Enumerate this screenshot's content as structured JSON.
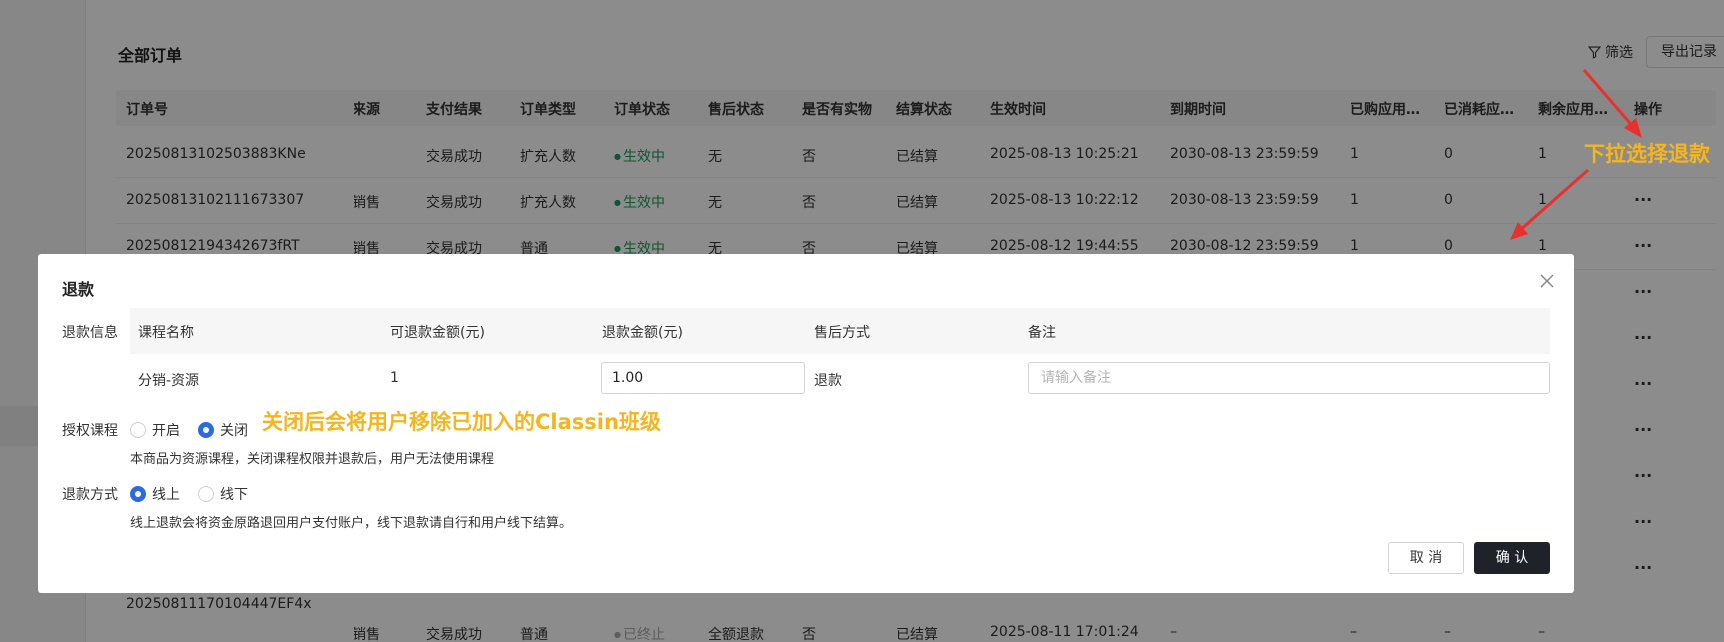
{
  "page": {
    "title": "全部订单",
    "filter_label": "筛选",
    "export_label": "导出记录"
  },
  "table": {
    "columns": [
      "订单号",
      "来源",
      "支付结果",
      "订单类型",
      "订单状态",
      "售后状态",
      "是否有实物",
      "结算状态",
      "生效时间",
      "到期时间",
      "已购应用…",
      "已消耗应…",
      "剩余应用…",
      "操作"
    ],
    "rows": [
      {
        "order_no": "20250813102503883KNe",
        "source": "",
        "pay": "交易成功",
        "type": "扩充人数",
        "status": "生效中",
        "after": "无",
        "physical": "否",
        "settle": "已结算",
        "start": "2025-08-13 10:25:21",
        "end": "2030-08-13 23:59:59",
        "bought": "1",
        "used": "0",
        "left": "1"
      },
      {
        "order_no": "20250813102111673307",
        "source": "销售",
        "pay": "交易成功",
        "type": "扩充人数",
        "status": "生效中",
        "after": "无",
        "physical": "否",
        "settle": "已结算",
        "start": "2025-08-13 10:22:12",
        "end": "2030-08-13 23:59:59",
        "bought": "1",
        "used": "0",
        "left": "1"
      },
      {
        "order_no": "20250812194342673fRT",
        "source": "销售",
        "pay": "交易成功",
        "type": "普通",
        "status": "生效中",
        "after": "无",
        "physical": "否",
        "settle": "已结算",
        "start": "2025-08-12 19:44:55",
        "end": "2030-08-12 23:59:59",
        "bought": "1",
        "used": "0",
        "left": "1"
      }
    ],
    "orphan_order_no": "20250811170104447EF4x",
    "last_row": {
      "source": "销售",
      "pay": "交易成功",
      "type": "普通",
      "status": "已终止",
      "after": "全额退款",
      "physical": "否",
      "settle": "已结算",
      "start": "2025-08-11 17:01:24",
      "end": "–",
      "bought": "–",
      "used": "–",
      "left": "–"
    },
    "more_icon": "···"
  },
  "annotations": {
    "dropdown_tip": "下拉选择退款",
    "classin_tip": "关闭后会将用户移除已加入的Classin班级",
    "color": "#f5b51f"
  },
  "modal": {
    "title": "退款",
    "refund_info_label": "退款信息",
    "headers": {
      "course_name": "课程名称",
      "refundable": "可退款金额(元)",
      "refund_amount": "退款金额(元)",
      "after_sale_method": "售后方式",
      "remark": "备注"
    },
    "row": {
      "course_name": "分销-资源",
      "refundable": "1",
      "refund_amount": "1.00",
      "after_sale_method": "退款",
      "remark_placeholder": "请输入备注"
    },
    "auth_course": {
      "label": "授权课程",
      "option_on": "开启",
      "option_off": "关闭",
      "selected": "关闭",
      "hint": "本商品为资源课程，关闭课程权限并退款后，用户无法使用课程"
    },
    "refund_method": {
      "label": "退款方式",
      "option_online": "线上",
      "option_offline": "线下",
      "selected": "线上",
      "hint": "线上退款会将资金原路退回用户支付账户，线下退款请自行和用户线下结算。"
    },
    "cancel_label": "取 消",
    "confirm_label": "确 认"
  }
}
